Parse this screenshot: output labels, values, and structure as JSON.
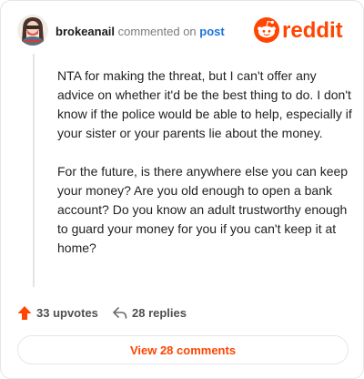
{
  "header": {
    "username": "brokeanail",
    "verb": "commented on",
    "target": "post",
    "brand": "reddit"
  },
  "comment": {
    "paragraphs": [
      "NTA for making the threat, but I can't offer any advice on whether it'd be the best thing to do. I don't know if the police would be able to help, especially if your sister or your parents lie about the money.",
      "For the future, is there anywhere else you can keep your money? Are you old enough to open a bank account? Do you know an adult trustworthy enough to guard your money for you if you can't keep it at home?"
    ]
  },
  "actions": {
    "upvotes": "33 upvotes",
    "replies": "28 replies"
  },
  "footer": {
    "view_comments": "View 28 comments"
  },
  "colors": {
    "brand": "#ff4500",
    "link": "#1b74d8"
  },
  "icons": {
    "upvote": "upvote-arrow-icon",
    "reply": "reply-arrow-icon",
    "logo": "reddit-snoo-icon"
  }
}
